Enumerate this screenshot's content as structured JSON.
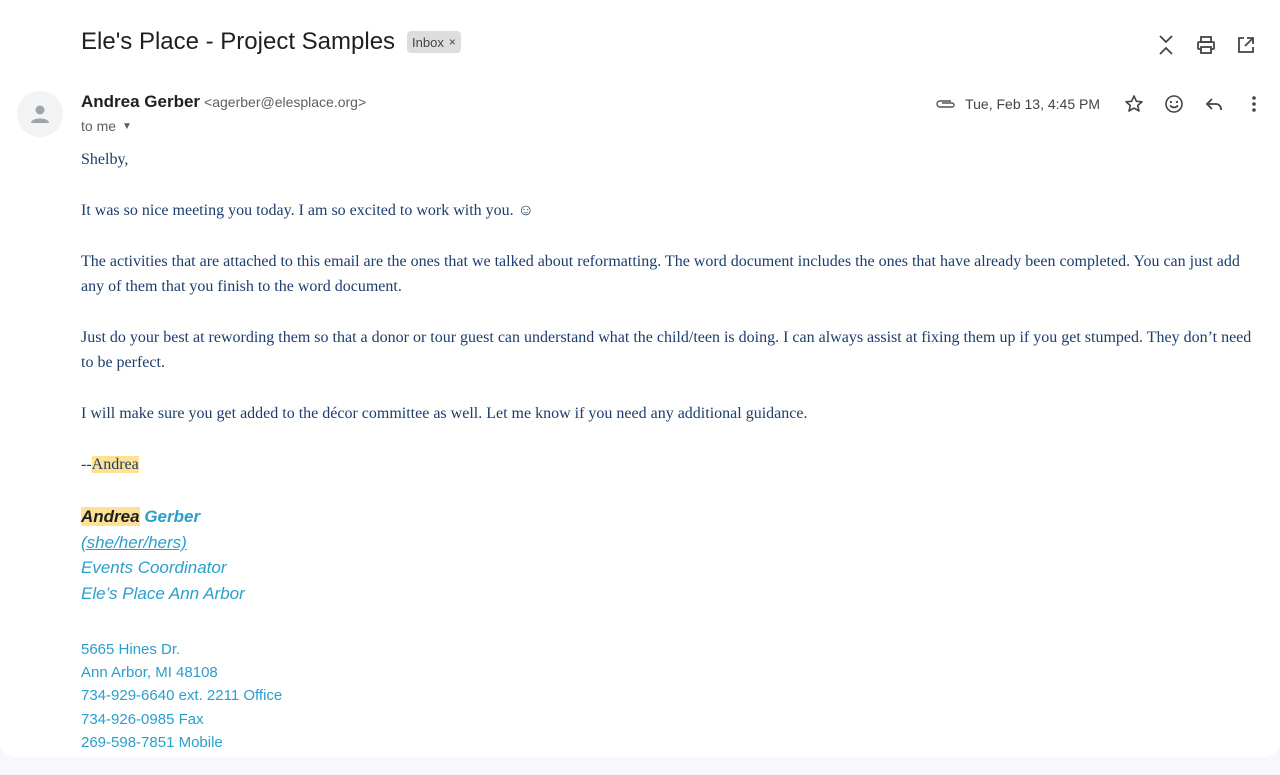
{
  "subject": "Ele's Place - Project Samples",
  "label": {
    "name": "Inbox",
    "remove": "×"
  },
  "top_actions": [
    "expand-all-icon",
    "print-icon",
    "open-in-new-window-icon"
  ],
  "sender": {
    "name": "Andrea Gerber",
    "email": "<agerber@elesplace.org>",
    "recipient": "to me",
    "date": "Tue, Feb 13, 4:45 PM"
  },
  "meta_actions": [
    "star-icon",
    "emoji-icon",
    "reply-icon",
    "more-vert-icon"
  ],
  "body": {
    "greeting": "Shelby,",
    "p1": "It was so nice meeting you today. I am so excited to work with you. ☺",
    "p2": "The activities that are attached to this email are the ones that we talked about reformatting. The word document includes the ones that have already been completed. You can just add any of them that you finish to the word document.",
    "p3": "Just do your best at rewording them so that a donor or tour guest can understand what the child/teen is doing. I can always assist at fixing them up if you get stumped. They don’t need to be perfect.",
    "p4": "I will make sure you get added to the décor committee as well. Let me know if you need any additional guidance.",
    "signoff_prefix": "--",
    "signoff_name": "Andrea"
  },
  "signature": {
    "first": "Andrea",
    "last": "Gerber",
    "pronouns": "(she/her/hers)",
    "title": "Events Coordinator",
    "org": "Ele’s Place Ann Arbor"
  },
  "address": {
    "street": "5665 Hines Dr.",
    "city": "Ann Arbor, MI 48108",
    "office": "734-929-6640 ext. 2211 Office",
    "fax": "734-926-0985 Fax",
    "mobile": "269-598-7851 Mobile"
  },
  "colors": {
    "body_text": "#1c3d6e",
    "signature": "#2b9fcc",
    "highlight": "#fde293"
  }
}
